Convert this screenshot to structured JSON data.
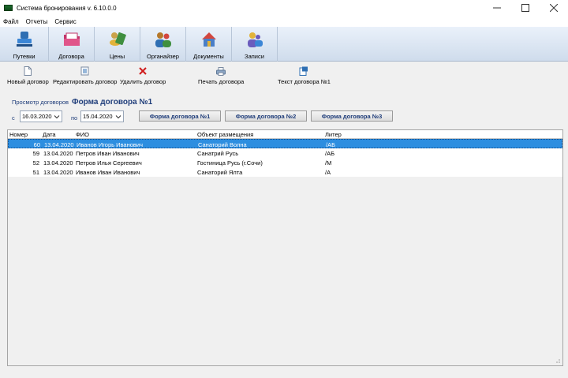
{
  "window": {
    "title": "Система бронирования v. 6.10.0.0"
  },
  "menu": [
    "Файл",
    "Отчеты",
    "Сервис"
  ],
  "toolbar": [
    {
      "label": "Путевки",
      "icon": "stamp-icon",
      "color": "#2f6fb3"
    },
    {
      "label": "Договора",
      "icon": "folder-icon",
      "color": "#c2366a"
    },
    {
      "label": "Цены",
      "icon": "money-icon",
      "color": "#3f8f3f"
    },
    {
      "label": "Органайзер",
      "icon": "people-icon",
      "color": "#b5782a"
    },
    {
      "label": "Документы",
      "icon": "documents-icon",
      "color": "#4a7fc7"
    },
    {
      "label": "Записи",
      "icon": "notes-icon",
      "color": "#6b5cbd"
    }
  ],
  "actions": {
    "new": "Новый договор",
    "edit": "Редактировать договор",
    "delete": "Удалить договор",
    "print": "Печать договора",
    "text": "Текст договора №1"
  },
  "panel": {
    "breadcrumb": "Просмотр договоров",
    "title": "Форма договора №1"
  },
  "filter": {
    "from_label": "с",
    "from_value": "16.03.2020",
    "to_label": "по",
    "to_value": "15.04.2020",
    "form1": "Форма договора №1",
    "form2": "Форма договора №2",
    "form3": "Форма договора №3"
  },
  "table": {
    "columns": [
      "Номер",
      "Дата",
      "ФИО",
      "Объект размещения",
      "Литер"
    ],
    "rows": [
      {
        "num": "60",
        "date": "13.04.2020",
        "fio": "Иванов Игорь Иванович",
        "object": "Санаторий Волна",
        "liter": "/АБ",
        "selected": true
      },
      {
        "num": "59",
        "date": "13.04.2020",
        "fio": "Петров Иван Иванович",
        "object": "Санатрий Русь",
        "liter": "/АБ",
        "selected": false
      },
      {
        "num": "52",
        "date": "13.04.2020",
        "fio": "Петров Илья Сергеевич",
        "object": "Гостиница Русь (г.Сочи)",
        "liter": "/М",
        "selected": false
      },
      {
        "num": "51",
        "date": "13.04.2020",
        "fio": "Иванов Иван Иванович",
        "object": "Санаторий Ялта",
        "liter": "/А",
        "selected": false
      }
    ]
  },
  "colors": {
    "selection": "#2d8ee0",
    "accent": "#1f3d7a"
  }
}
